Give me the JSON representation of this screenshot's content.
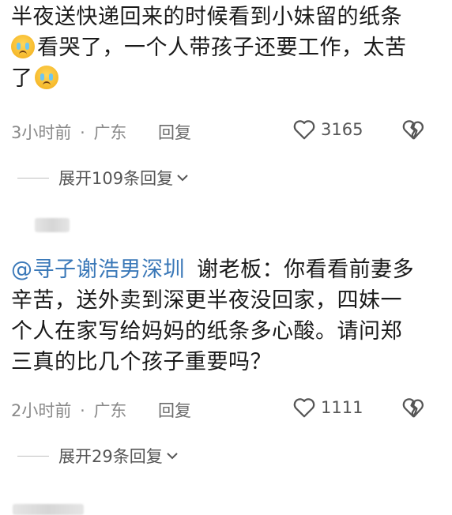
{
  "comment1": {
    "line1": "半夜送快递回来的时候看到小妹留的纸条",
    "line2": "看哭了，一个人带孩子还要工作，太苦",
    "line3": "了",
    "emoji_icon": "loudly-crying-face-icon",
    "time": "3小时前",
    "dot": "·",
    "location": "广东",
    "reply_label": "回复",
    "like_count": "3165",
    "expand_label": "展开109条回复"
  },
  "comment2": {
    "mention": "@寻子谢浩男深圳",
    "line1_rest": "谢老板：你看看前妻多",
    "line2": "辛苦，送外卖到深更半夜没回家，四妹一",
    "line3": "个人在家写给妈妈的纸条多心酸。请问郑",
    "line4": "三真的比几个孩子重要吗？",
    "time": "2小时前",
    "dot": "·",
    "location": "广东",
    "reply_label": "回复",
    "like_count": "1111",
    "expand_label": "展开29条回复"
  },
  "colors": {
    "mention": "#3a78b8",
    "meta": "#8a8a8a",
    "text": "#1a1a1a"
  },
  "icons": {
    "like": "heart-outline-icon",
    "dislike": "broken-heart-icon",
    "expand": "chevron-down-icon"
  }
}
